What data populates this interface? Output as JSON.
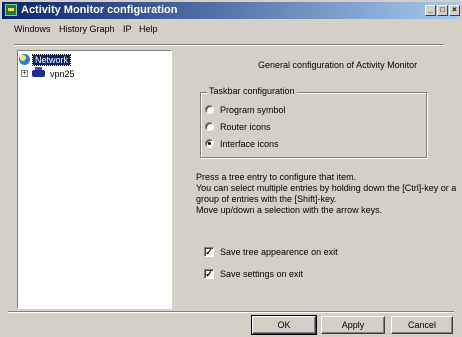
{
  "window": {
    "title": "Activity Monitor configuration",
    "minimize_glyph": "_",
    "maximize_glyph": "□",
    "close_glyph": "×"
  },
  "menu": [
    "Windows",
    "History Graph",
    "IP",
    "Help"
  ],
  "tree": {
    "root": {
      "label": "Network",
      "icon": "network-globe-icon"
    },
    "children": [
      {
        "label": "vpn25",
        "icon": "router-icon",
        "expander": "+"
      }
    ]
  },
  "panel": {
    "heading": "General configuration of Activity Monitor",
    "taskbar_group": {
      "legend": "Taskbar configuration",
      "options": [
        {
          "label": "Program symbol",
          "selected": false
        },
        {
          "label": "Router icons",
          "selected": false
        },
        {
          "label": "Interface icons",
          "selected": true
        }
      ]
    },
    "info_lines": [
      "Press a tree entry to configure that item.",
      "You can select multiple entries by holding down the [Ctrl]-key or a",
      "group of entries with the [Shift]-key.",
      "Move up/down a selection with the arrow keys."
    ],
    "checkboxes": [
      {
        "label": "Save tree appearence on exit",
        "checked": true,
        "mark": "✓"
      },
      {
        "label": "Save settings on exit",
        "checked": true,
        "mark": "✓"
      }
    ]
  },
  "buttons": {
    "ok": "OK",
    "apply": "Apply",
    "cancel": "Cancel"
  }
}
